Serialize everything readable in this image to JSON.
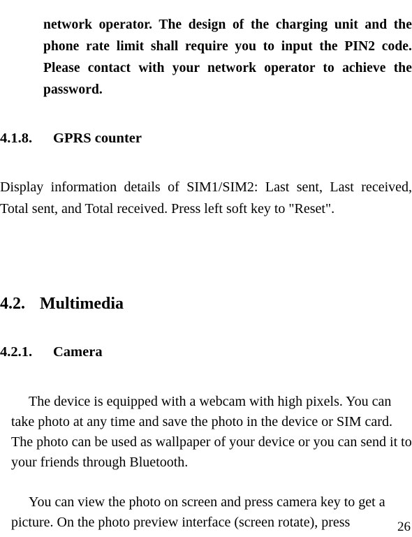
{
  "document": {
    "page_number": "26",
    "blocks": {
      "continued_paragraph": "network operator. The design of the charging unit and the phone rate limit shall require you to input the PIN2 code. Please contact with your network operator to achieve the password.",
      "heading_gprs_counter": {
        "number": "4.1.8.",
        "title": "GPRS counter"
      },
      "gprs_counter_body": "Display information details of SIM1/SIM2: Last sent, Last received, Total sent, and Total received. Press left soft key to \"Reset\".",
      "heading_multimedia": {
        "number": "4.2.",
        "title": "Multimedia"
      },
      "heading_camera": {
        "number": "4.2.1.",
        "title": "Camera"
      },
      "camera_body_first": "The device is equipped with a webcam with high pixels. You can take photo at any time and save the photo in the device or SIM card. The photo can be used as wallpaper of your device or you can send it to your friends through Bluetooth.",
      "camera_body_second": "You can view the photo on screen and press camera key to get a picture. On the photo preview interface (screen rotate), press"
    }
  }
}
